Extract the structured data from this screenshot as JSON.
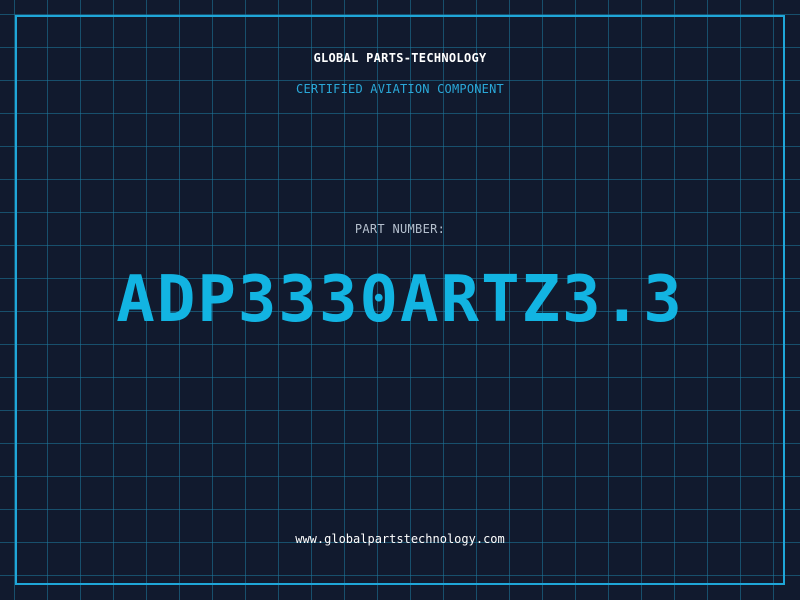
{
  "header": {
    "brand": "GLOBAL PARTS-TECHNOLOGY",
    "tagline": "CERTIFIED AVIATION COMPONENT"
  },
  "main": {
    "label": "PART NUMBER:",
    "part_number": "ADP3330ARTZ3.3"
  },
  "footer": {
    "website": "www.globalpartstechnology.com"
  },
  "colors": {
    "background": "#111a2e",
    "grid": "#1c7a9e",
    "frame": "#1fa6d8",
    "accent": "#12b4e2",
    "label": "#b4bfcd",
    "text": "#ffffff"
  }
}
